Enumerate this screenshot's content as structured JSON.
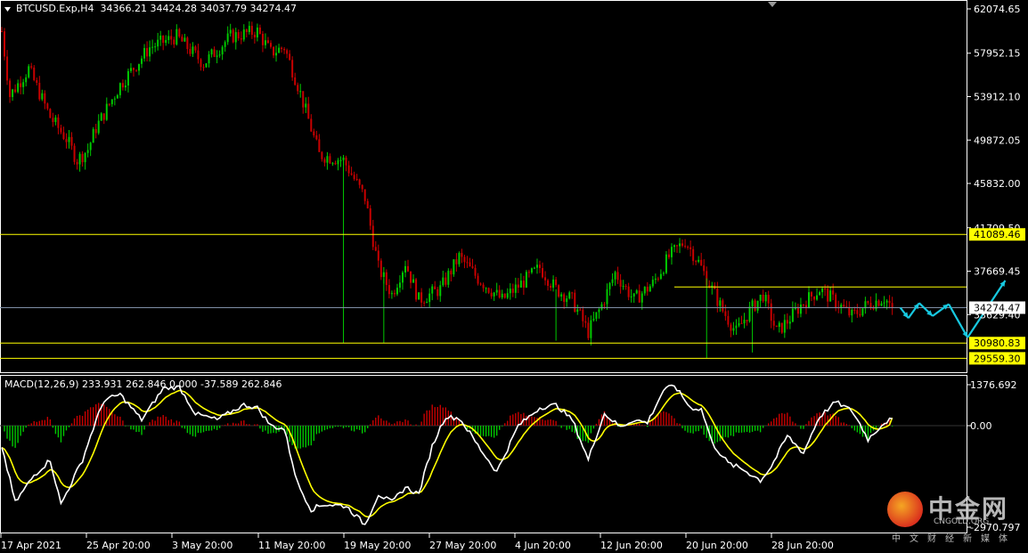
{
  "header": {
    "symbol": "BTCUSD.Exp,H4",
    "ohlc": "34366.21 34424.28 34037.79 34274.47",
    "macd_label": "MACD(12,26,9) 233.931 262.846 0.000 -37.589 262.846"
  },
  "price_axis": {
    "ticks": [
      "62074.65",
      "57952.15",
      "53912.10",
      "49872.05",
      "45832.00",
      "41709.50",
      "37669.45",
      "33629.40"
    ],
    "range": [
      28100,
      62074.65
    ]
  },
  "macd_axis": {
    "ticks": [
      "1376.692",
      "0.00",
      "-2970.797"
    ],
    "range": [
      -2970.797,
      1376.692
    ]
  },
  "level_tags": [
    "41089.46",
    "30980.83",
    "29559.30"
  ],
  "current_price": "34274.47",
  "dates": [
    "17 Apr 2021",
    "25 Apr 20:00",
    "3 May 20:00",
    "11 May 20:00",
    "19 May 20:00",
    "27 May 20:00",
    "4 Jun 20:00",
    "12 Jun 20:00",
    "20 Jun 20:00",
    "28 Jun 20:00"
  ],
  "watermark": {
    "name_cn": "中金网",
    "name_en": "CNGOLD.ORG",
    "tagline": "中文财经新媒体"
  },
  "colors": {
    "bull": "#00c800",
    "bear": "#c80000",
    "level": "#ffff00",
    "macd_line": "#ffffff",
    "signal_line": "#ffff00",
    "projection": "#17c8e0"
  },
  "chart_data": {
    "type": "candlestick",
    "timeframe": "H4",
    "symbol": "BTCUSD.Exp",
    "price_path": [
      [
        0,
        60000
      ],
      [
        3,
        54000
      ],
      [
        10,
        56500
      ],
      [
        18,
        52000
      ],
      [
        24,
        50000
      ],
      [
        28,
        48000
      ],
      [
        32,
        49000
      ],
      [
        35,
        51000
      ],
      [
        44,
        55000
      ],
      [
        55,
        58500
      ],
      [
        65,
        59500
      ],
      [
        75,
        57000
      ],
      [
        85,
        59500
      ],
      [
        95,
        60000
      ],
      [
        100,
        58000
      ],
      [
        105,
        58500
      ],
      [
        110,
        55000
      ],
      [
        118,
        48500
      ],
      [
        127,
        48000
      ],
      [
        135,
        44500
      ],
      [
        140,
        38000
      ],
      [
        145,
        35500
      ],
      [
        150,
        38500
      ],
      [
        155,
        35000
      ],
      [
        163,
        36000
      ],
      [
        170,
        39000
      ],
      [
        177,
        37000
      ],
      [
        186,
        35000
      ],
      [
        193,
        36500
      ],
      [
        200,
        38000
      ],
      [
        206,
        36000
      ],
      [
        212,
        35000
      ],
      [
        218,
        32000
      ],
      [
        223,
        34500
      ],
      [
        228,
        37500
      ],
      [
        235,
        35000
      ],
      [
        242,
        36500
      ],
      [
        248,
        39000
      ],
      [
        254,
        40500
      ],
      [
        259,
        38500
      ],
      [
        263,
        36500
      ],
      [
        268,
        34000
      ],
      [
        273,
        32000
      ],
      [
        278,
        34000
      ],
      [
        283,
        35500
      ],
      [
        288,
        32000
      ],
      [
        292,
        33000
      ],
      [
        297,
        34500
      ],
      [
        304,
        36000
      ],
      [
        310,
        34800
      ],
      [
        316,
        33500
      ],
      [
        322,
        34600
      ],
      [
        328,
        35200
      ],
      [
        331,
        34274.47
      ]
    ],
    "levels": [
      41089.46,
      30980.83,
      29559.3
    ],
    "resistance_short": 36200,
    "projection_path": [
      [
        334,
        34274.47
      ],
      [
        337,
        33300
      ],
      [
        341,
        34700
      ],
      [
        346,
        33500
      ],
      [
        352,
        34600
      ],
      [
        359,
        31500
      ],
      [
        373,
        36800
      ]
    ],
    "macd_path": [
      [
        0,
        -600
      ],
      [
        5,
        -2250
      ],
      [
        12,
        -1450
      ],
      [
        18,
        -1000
      ],
      [
        22,
        -2300
      ],
      [
        30,
        -1000
      ],
      [
        38,
        850
      ],
      [
        44,
        1050
      ],
      [
        52,
        200
      ],
      [
        60,
        1250
      ],
      [
        66,
        1300
      ],
      [
        72,
        400
      ],
      [
        80,
        200
      ],
      [
        90,
        700
      ],
      [
        95,
        600
      ],
      [
        100,
        0
      ],
      [
        105,
        -100
      ],
      [
        110,
        -1700
      ],
      [
        115,
        -2450
      ],
      [
        120,
        -2300
      ],
      [
        128,
        -2350
      ],
      [
        135,
        -2900
      ],
      [
        140,
        -2000
      ],
      [
        145,
        -2250
      ],
      [
        150,
        -1800
      ],
      [
        155,
        -2000
      ],
      [
        160,
        -600
      ],
      [
        165,
        300
      ],
      [
        170,
        250
      ],
      [
        178,
        -700
      ],
      [
        184,
        -1350
      ],
      [
        192,
        0
      ],
      [
        200,
        600
      ],
      [
        206,
        700
      ],
      [
        212,
        200
      ],
      [
        218,
        -1000
      ],
      [
        224,
        400
      ],
      [
        230,
        -50
      ],
      [
        235,
        200
      ],
      [
        240,
        100
      ],
      [
        246,
        1200
      ],
      [
        250,
        1350
      ],
      [
        256,
        600
      ],
      [
        260,
        550
      ],
      [
        264,
        -500
      ],
      [
        270,
        -1100
      ],
      [
        276,
        -1300
      ],
      [
        282,
        -1600
      ],
      [
        286,
        -1200
      ],
      [
        292,
        -300
      ],
      [
        298,
        -800
      ],
      [
        304,
        300
      ],
      [
        310,
        800
      ],
      [
        316,
        500
      ],
      [
        322,
        -400
      ],
      [
        328,
        100
      ],
      [
        331,
        234
      ]
    ],
    "macd_last": 233.931,
    "signal_last": 262.846,
    "macd_ylim": [
      -2970.797,
      1376.692
    ],
    "ylim": [
      28100,
      62074.65
    ]
  }
}
